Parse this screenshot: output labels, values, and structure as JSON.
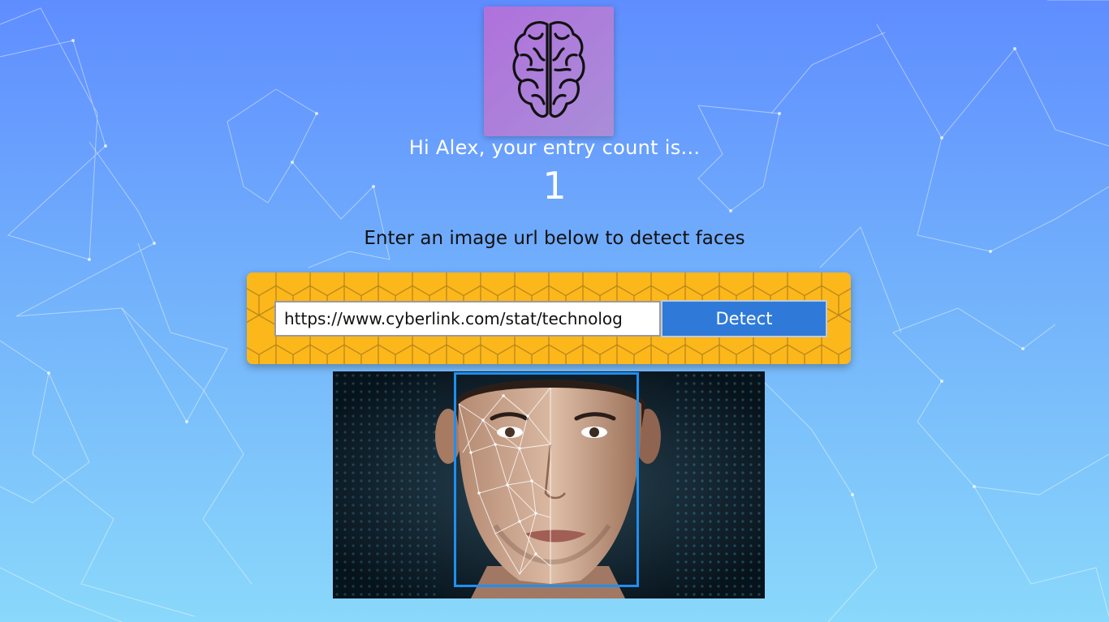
{
  "app": {
    "logo_icon": "brain-icon",
    "logo_gradient": [
      "#b070dc",
      "#a98ed8"
    ]
  },
  "greeting": {
    "text": "Hi Alex, your entry count is..."
  },
  "entry_count": {
    "value": "1"
  },
  "instruction": {
    "text": "Enter an image url below to detect faces"
  },
  "form": {
    "url_value": "https://www.cyberlink.com/stat/technolog",
    "detect_label": "Detect",
    "panel_color": "#fcb71b",
    "button_color": "#2f7ad9"
  },
  "result": {
    "image_subject": "face-with-mesh-overlay",
    "face_box_color": "#1f8ff0"
  }
}
